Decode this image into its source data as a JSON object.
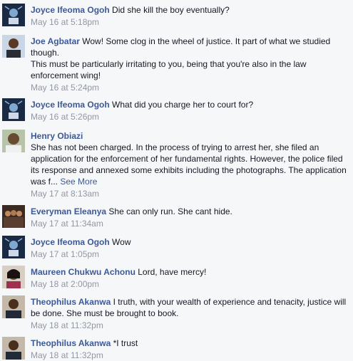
{
  "comments": [
    {
      "author": "Joyce Ifeoma Ogoh",
      "text": "Did she kill the boy eventually?",
      "time": "May 16 at 5:18pm"
    },
    {
      "author": "Joe Agbatar",
      "text": "Wow! Some clog in the wheel of justice. It part of what we studied though.",
      "text2": "This must be particularly irritating to you, being that you're also in the law enforcement wing!",
      "time": "May 16 at 5:24pm"
    },
    {
      "author": "Joyce Ifeoma Ogoh",
      "text": "What did you charge her to court for?",
      "time": "May 16 at 5:26pm"
    },
    {
      "author": "Henry Obiazi",
      "text": "She has not been charged. In the process of trying to arrest her, she filed an application for the enforcement of her fundamental rights. However, the police filed its response and annexed some exhibits including the photographs. The application was f...",
      "see_more": "See More",
      "time": "May 17 at 8:13am"
    },
    {
      "author": "Everyman Eleanya",
      "text": "She can only run. She cant hide.",
      "time": "May 17 at 11:34am"
    },
    {
      "author": "Joyce Ifeoma Ogoh",
      "text": "Wow",
      "time": "May 17 at 1:05pm"
    },
    {
      "author": "Maureen Chukwu Achonu",
      "text": "Lord, have mercy!",
      "time": "May 18 at 2:00pm"
    },
    {
      "author": "Theophilus Akanwa",
      "text": "I truth, with your wealth of experience and tenacity, justice will be done. She must be brought to book.",
      "time": "May 18 at 11:32pm"
    },
    {
      "author": "Theophilus Akanwa",
      "text": "*I trust",
      "time": "May 18 at 11:32pm"
    }
  ]
}
